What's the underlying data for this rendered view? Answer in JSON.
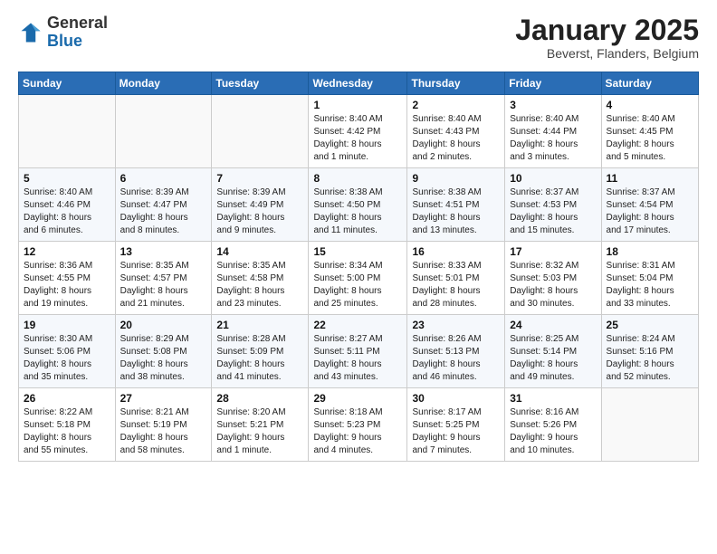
{
  "logo": {
    "general": "General",
    "blue": "Blue"
  },
  "title": "January 2025",
  "subtitle": "Beverst, Flanders, Belgium",
  "days_header": [
    "Sunday",
    "Monday",
    "Tuesday",
    "Wednesday",
    "Thursday",
    "Friday",
    "Saturday"
  ],
  "weeks": [
    [
      {
        "day": "",
        "info": ""
      },
      {
        "day": "",
        "info": ""
      },
      {
        "day": "",
        "info": ""
      },
      {
        "day": "1",
        "info": "Sunrise: 8:40 AM\nSunset: 4:42 PM\nDaylight: 8 hours\nand 1 minute."
      },
      {
        "day": "2",
        "info": "Sunrise: 8:40 AM\nSunset: 4:43 PM\nDaylight: 8 hours\nand 2 minutes."
      },
      {
        "day": "3",
        "info": "Sunrise: 8:40 AM\nSunset: 4:44 PM\nDaylight: 8 hours\nand 3 minutes."
      },
      {
        "day": "4",
        "info": "Sunrise: 8:40 AM\nSunset: 4:45 PM\nDaylight: 8 hours\nand 5 minutes."
      }
    ],
    [
      {
        "day": "5",
        "info": "Sunrise: 8:40 AM\nSunset: 4:46 PM\nDaylight: 8 hours\nand 6 minutes."
      },
      {
        "day": "6",
        "info": "Sunrise: 8:39 AM\nSunset: 4:47 PM\nDaylight: 8 hours\nand 8 minutes."
      },
      {
        "day": "7",
        "info": "Sunrise: 8:39 AM\nSunset: 4:49 PM\nDaylight: 8 hours\nand 9 minutes."
      },
      {
        "day": "8",
        "info": "Sunrise: 8:38 AM\nSunset: 4:50 PM\nDaylight: 8 hours\nand 11 minutes."
      },
      {
        "day": "9",
        "info": "Sunrise: 8:38 AM\nSunset: 4:51 PM\nDaylight: 8 hours\nand 13 minutes."
      },
      {
        "day": "10",
        "info": "Sunrise: 8:37 AM\nSunset: 4:53 PM\nDaylight: 8 hours\nand 15 minutes."
      },
      {
        "day": "11",
        "info": "Sunrise: 8:37 AM\nSunset: 4:54 PM\nDaylight: 8 hours\nand 17 minutes."
      }
    ],
    [
      {
        "day": "12",
        "info": "Sunrise: 8:36 AM\nSunset: 4:55 PM\nDaylight: 8 hours\nand 19 minutes."
      },
      {
        "day": "13",
        "info": "Sunrise: 8:35 AM\nSunset: 4:57 PM\nDaylight: 8 hours\nand 21 minutes."
      },
      {
        "day": "14",
        "info": "Sunrise: 8:35 AM\nSunset: 4:58 PM\nDaylight: 8 hours\nand 23 minutes."
      },
      {
        "day": "15",
        "info": "Sunrise: 8:34 AM\nSunset: 5:00 PM\nDaylight: 8 hours\nand 25 minutes."
      },
      {
        "day": "16",
        "info": "Sunrise: 8:33 AM\nSunset: 5:01 PM\nDaylight: 8 hours\nand 28 minutes."
      },
      {
        "day": "17",
        "info": "Sunrise: 8:32 AM\nSunset: 5:03 PM\nDaylight: 8 hours\nand 30 minutes."
      },
      {
        "day": "18",
        "info": "Sunrise: 8:31 AM\nSunset: 5:04 PM\nDaylight: 8 hours\nand 33 minutes."
      }
    ],
    [
      {
        "day": "19",
        "info": "Sunrise: 8:30 AM\nSunset: 5:06 PM\nDaylight: 8 hours\nand 35 minutes."
      },
      {
        "day": "20",
        "info": "Sunrise: 8:29 AM\nSunset: 5:08 PM\nDaylight: 8 hours\nand 38 minutes."
      },
      {
        "day": "21",
        "info": "Sunrise: 8:28 AM\nSunset: 5:09 PM\nDaylight: 8 hours\nand 41 minutes."
      },
      {
        "day": "22",
        "info": "Sunrise: 8:27 AM\nSunset: 5:11 PM\nDaylight: 8 hours\nand 43 minutes."
      },
      {
        "day": "23",
        "info": "Sunrise: 8:26 AM\nSunset: 5:13 PM\nDaylight: 8 hours\nand 46 minutes."
      },
      {
        "day": "24",
        "info": "Sunrise: 8:25 AM\nSunset: 5:14 PM\nDaylight: 8 hours\nand 49 minutes."
      },
      {
        "day": "25",
        "info": "Sunrise: 8:24 AM\nSunset: 5:16 PM\nDaylight: 8 hours\nand 52 minutes."
      }
    ],
    [
      {
        "day": "26",
        "info": "Sunrise: 8:22 AM\nSunset: 5:18 PM\nDaylight: 8 hours\nand 55 minutes."
      },
      {
        "day": "27",
        "info": "Sunrise: 8:21 AM\nSunset: 5:19 PM\nDaylight: 8 hours\nand 58 minutes."
      },
      {
        "day": "28",
        "info": "Sunrise: 8:20 AM\nSunset: 5:21 PM\nDaylight: 9 hours\nand 1 minute."
      },
      {
        "day": "29",
        "info": "Sunrise: 8:18 AM\nSunset: 5:23 PM\nDaylight: 9 hours\nand 4 minutes."
      },
      {
        "day": "30",
        "info": "Sunrise: 8:17 AM\nSunset: 5:25 PM\nDaylight: 9 hours\nand 7 minutes."
      },
      {
        "day": "31",
        "info": "Sunrise: 8:16 AM\nSunset: 5:26 PM\nDaylight: 9 hours\nand 10 minutes."
      },
      {
        "day": "",
        "info": ""
      }
    ]
  ]
}
